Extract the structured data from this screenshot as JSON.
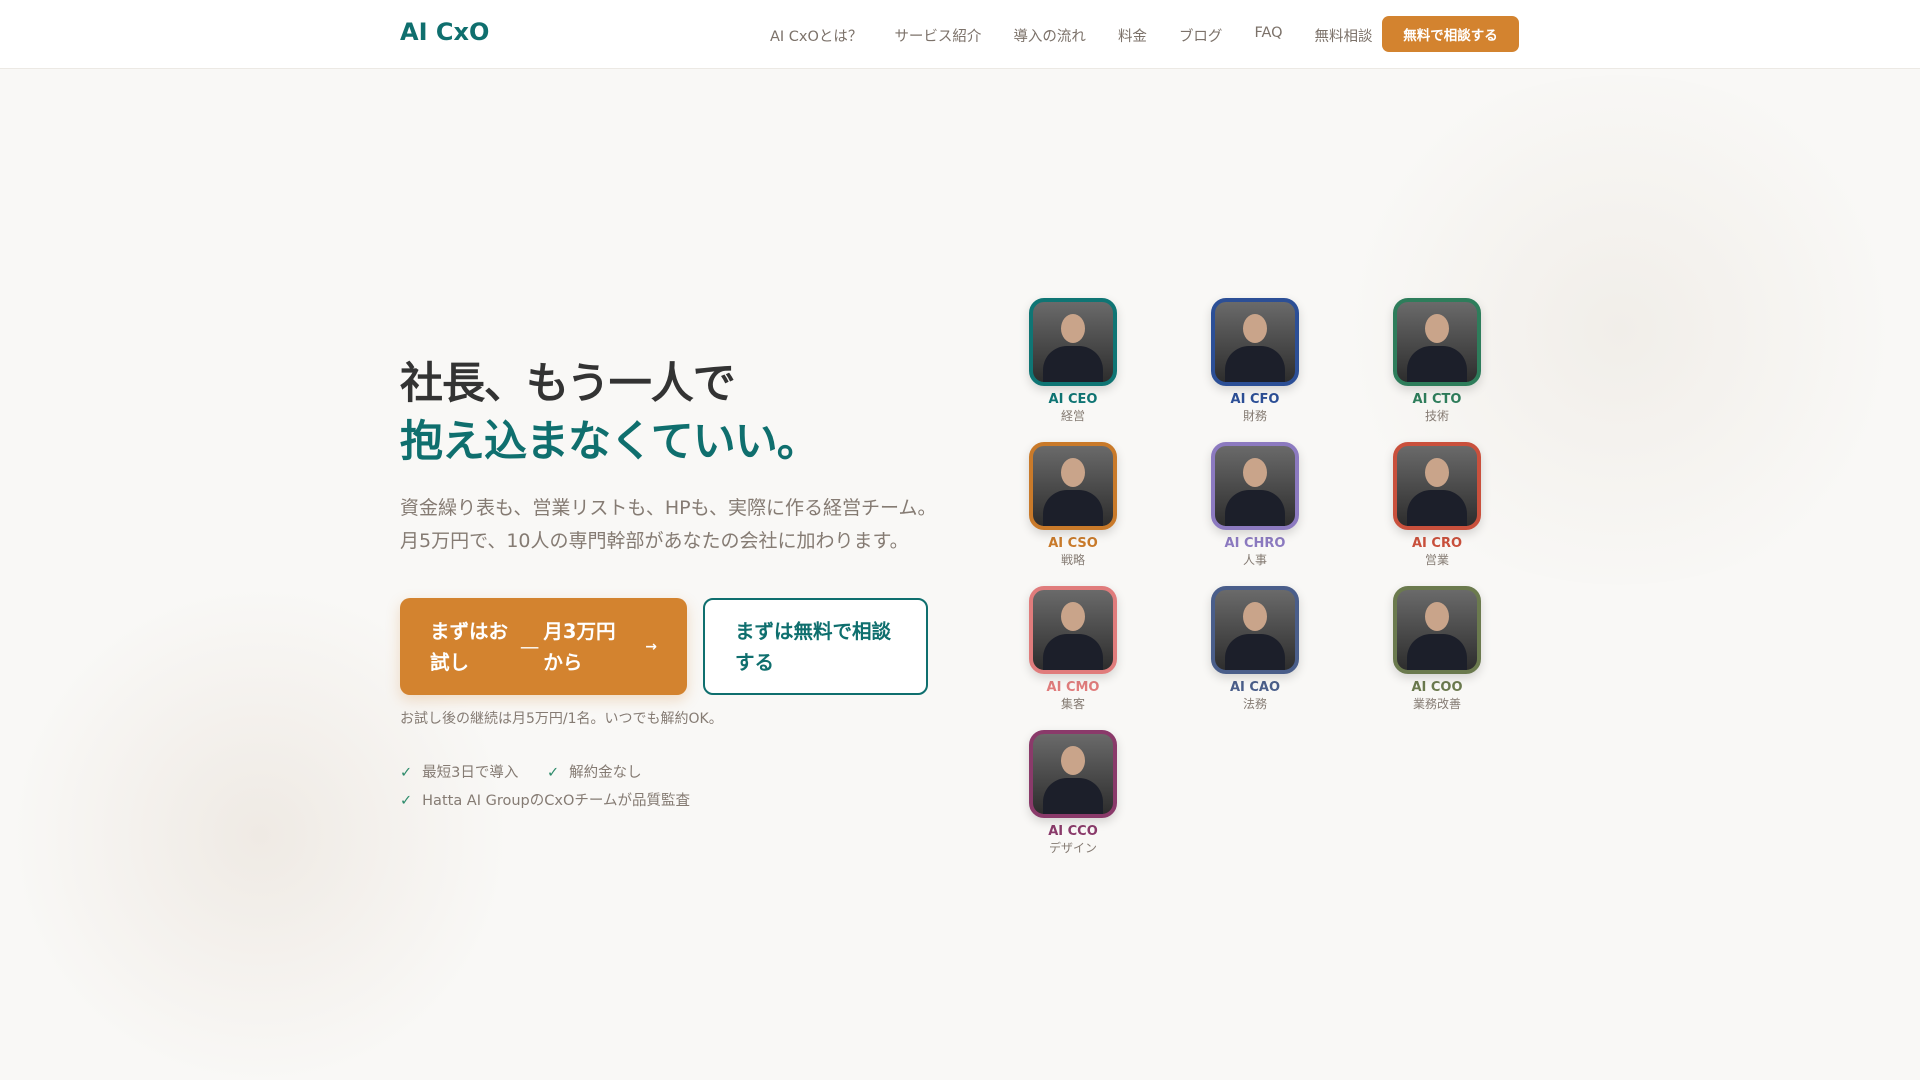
{
  "header": {
    "logo": "AI CxO",
    "nav": [
      "AI CxOとは？",
      "サービス紹介",
      "導入の流れ",
      "料金",
      "ブログ",
      "FAQ",
      "無料相談"
    ],
    "cta": "無料で相談する"
  },
  "hero": {
    "title_line1": "社長、もう一人で",
    "title_line2": "抱え込まなくていい。",
    "sub_line1": "資金繰り表も、営業リストも、HPも、実際に作る経営チーム。",
    "sub_line2": "月5万円で、10人の専門幹部があなたの会社に加わります。",
    "primary_a": "まずはお試し",
    "primary_dash": "—",
    "primary_b": "月3万円から",
    "primary_arrow": "→",
    "secondary": "まずは無料で相談する",
    "note": "お試し後の継続は月5万円/1名。いつでも解約OK。",
    "checks": [
      "最短3日で導入",
      "解約金なし",
      "Hatta AI GroupのCxOチームが品質監査"
    ]
  },
  "team": [
    {
      "role": "AI CEO",
      "dept": "経営",
      "color": "#0f7574"
    },
    {
      "role": "AI CFO",
      "dept": "財務",
      "color": "#2c4f96"
    },
    {
      "role": "AI CTO",
      "dept": "技術",
      "color": "#2e7d5b"
    },
    {
      "role": "AI CSO",
      "dept": "戦略",
      "color": "#c97a2a"
    },
    {
      "role": "AI CHRO",
      "dept": "人事",
      "color": "#8c7ac0"
    },
    {
      "role": "AI CRO",
      "dept": "営業",
      "color": "#c9503c"
    },
    {
      "role": "AI CMO",
      "dept": "集客",
      "color": "#e07c7c"
    },
    {
      "role": "AI CAO",
      "dept": "法務",
      "color": "#4a5e8a"
    },
    {
      "role": "AI COO",
      "dept": "業務改善",
      "color": "#6b7a4e"
    },
    {
      "role": "AI CCO",
      "dept": "デザイン",
      "color": "#8a3a6a"
    }
  ]
}
